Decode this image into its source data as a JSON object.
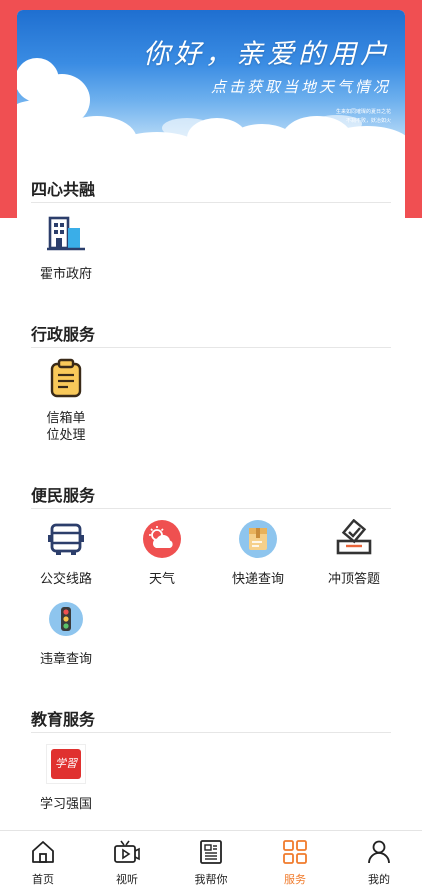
{
  "banner": {
    "greeting": "你好，亲爱的用户",
    "subtitle": "点击获取当地天气情况",
    "small_line1": "生来如同璀璨的夏日之花",
    "small_line2": "不凋不败，妖冶如火"
  },
  "sections": {
    "s1": {
      "title": "四心共融",
      "items": [
        {
          "label": "霍市政府",
          "icon": "building-icon"
        }
      ]
    },
    "s2": {
      "title": "行政服务",
      "items": [
        {
          "label": "信箱单位处理",
          "icon": "clipboard-icon"
        }
      ]
    },
    "s3": {
      "title": "便民服务",
      "items": [
        {
          "label": "公交线路",
          "icon": "bus-icon"
        },
        {
          "label": "天气",
          "icon": "weather-icon"
        },
        {
          "label": "快递查询",
          "icon": "package-icon"
        },
        {
          "label": "冲顶答题",
          "icon": "ballot-icon"
        },
        {
          "label": "违章查询",
          "icon": "traffic-light-icon"
        }
      ]
    },
    "s4": {
      "title": "教育服务",
      "items": [
        {
          "label": "学习强国",
          "icon": "xuexi-icon",
          "logo_text": "学習"
        }
      ]
    }
  },
  "tabbar": {
    "items": [
      {
        "label": "首页",
        "icon": "home-icon"
      },
      {
        "label": "视听",
        "icon": "tv-icon"
      },
      {
        "label": "我帮你",
        "icon": "newspaper-icon"
      },
      {
        "label": "服务",
        "icon": "grid-icon"
      },
      {
        "label": "我的",
        "icon": "person-icon"
      }
    ],
    "active": "服务"
  },
  "colors": {
    "header_red": "#f04f52",
    "active_orange": "#f07b2c",
    "navy": "#2c3e6b"
  }
}
